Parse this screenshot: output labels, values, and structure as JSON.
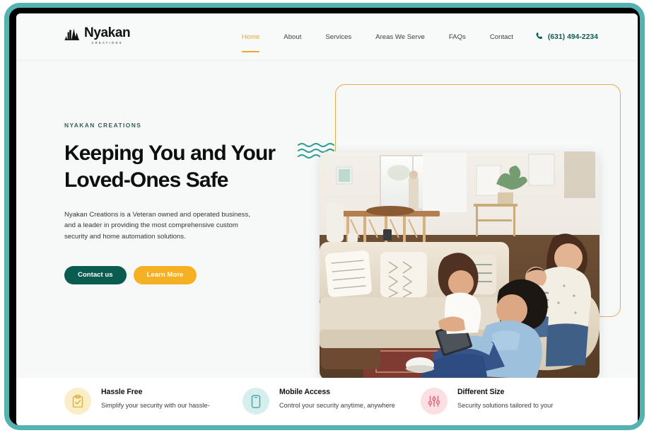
{
  "brand": {
    "logo_word": "Nyakan",
    "logo_sub": "CREATIONS",
    "logo_mark_icon": "mountain-skyline-icon"
  },
  "nav": {
    "items": [
      {
        "label": "Home",
        "active": true
      },
      {
        "label": "About",
        "active": false
      },
      {
        "label": "Services",
        "active": false
      },
      {
        "label": "Areas We Serve",
        "active": false
      },
      {
        "label": "FAQs",
        "active": false
      },
      {
        "label": "Contact",
        "active": false
      }
    ],
    "phone": {
      "number": "(631) 494-2234",
      "icon": "phone-icon",
      "color": "#0d5b52"
    }
  },
  "hero": {
    "eyebrow": "NYAKAN CREATIONS",
    "headline": "Keeping You and Your Loved-Ones Safe",
    "paragraph": "Nyakan Creations is a Veteran owned and operated business, and a leader in providing the most comprehensive custom security and home automation solutions.",
    "primary_button": "Contact us",
    "secondary_button": "Learn More",
    "decoration_icon": "wavy-lines-icon",
    "photo_alt": "family-in-living-room-photo"
  },
  "features": [
    {
      "title": "Hassle Free",
      "description": "Simplify your security with our hassle-",
      "icon": "clipboard-check-icon",
      "circle_color": "#faeec8",
      "icon_color": "#e0b546"
    },
    {
      "title": "Mobile Access",
      "description": "Control your security anytime, anywhere",
      "icon": "mobile-phone-icon",
      "circle_color": "#d6eeee",
      "icon_color": "#4aa8a5"
    },
    {
      "title": "Different Size",
      "description": "Security solutions tailored to your",
      "icon": "sliders-icon",
      "circle_color": "#fbdfe3",
      "icon_color": "#e2697d"
    }
  ],
  "theme": {
    "frame_color": "#54b3b0",
    "accent_gold": "#e8a82a",
    "accent_teal": "#0a5c50",
    "hero_bg": "#f7f8f8"
  }
}
